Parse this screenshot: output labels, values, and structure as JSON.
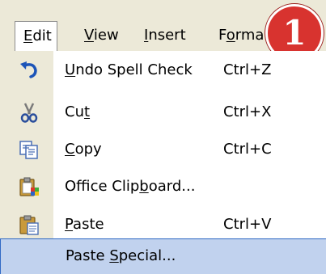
{
  "menubar": {
    "edit": "Edit",
    "view": "View",
    "insert": "Insert",
    "format": "Forma"
  },
  "badge": "1",
  "menu": {
    "items": [
      {
        "label": "Undo Spell Check",
        "shortcut": "Ctrl+Z",
        "icon": "undo-icon"
      },
      {
        "label": "Cut",
        "shortcut": "Ctrl+X",
        "icon": "scissors-icon"
      },
      {
        "label": "Copy",
        "shortcut": "Ctrl+C",
        "icon": "copy-icon"
      },
      {
        "label": "Office Clipboard...",
        "shortcut": "",
        "icon": "office-clipboard-icon"
      },
      {
        "label": "Paste",
        "shortcut": "Ctrl+V",
        "icon": "paste-icon"
      },
      {
        "label": "Paste Special...",
        "shortcut": "",
        "icon": ""
      }
    ]
  },
  "colors": {
    "menubar_bg": "#ece9d8",
    "highlight": "#c1d2ee",
    "badge": "#d8332f"
  }
}
